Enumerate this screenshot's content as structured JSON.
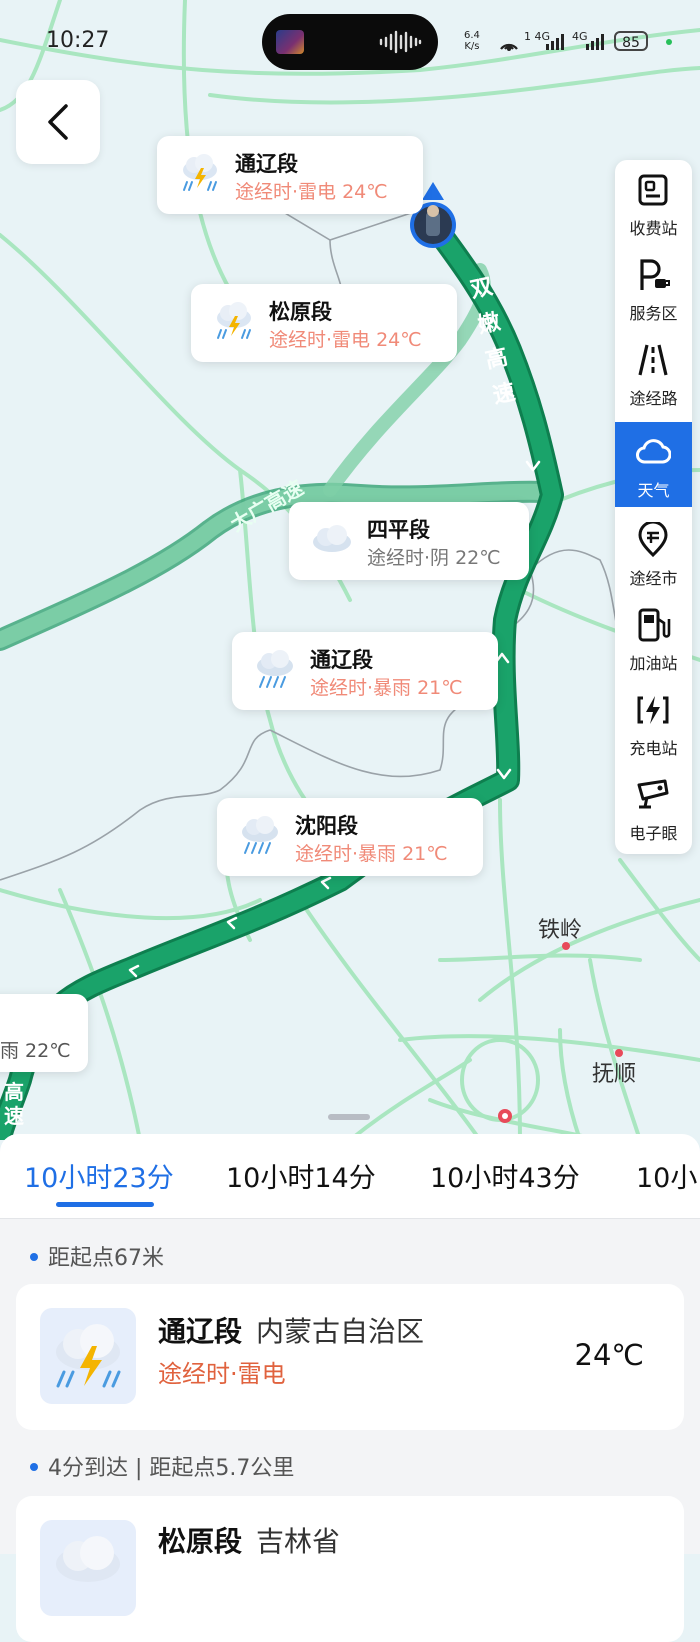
{
  "status_bar": {
    "time": "10:27",
    "net_speed_value": "6.4",
    "net_speed_unit": "K/s",
    "sim1": "1 4G",
    "sim2": "4G",
    "battery": "85"
  },
  "map": {
    "road_label": "双嫩高速",
    "road_label_2": "大广高速",
    "road_label_3": "高速",
    "cities": [
      "铁岭",
      "抚顺"
    ],
    "callouts": [
      {
        "name": "通辽段",
        "desc": "途经时·雷电 24℃",
        "icon": "thunderstorm-icon"
      },
      {
        "name": "松原段",
        "desc": "途经时·雷电 24℃",
        "icon": "thunderstorm-icon"
      },
      {
        "name": "四平段",
        "desc": "途经时·阴 22℃",
        "icon": "cloudy-icon"
      },
      {
        "name": "通辽段",
        "desc": "途经时·暴雨 21℃",
        "icon": "heavy-rain-icon"
      },
      {
        "name": "沈阳段",
        "desc": "途经时·暴雨 21℃",
        "icon": "heavy-rain-icon"
      },
      {
        "name": "",
        "desc": "雨 22℃",
        "icon": ""
      }
    ],
    "colors": {
      "route": "#1aa36a",
      "route_dark": "#0e7f4f",
      "road": "#9de3b6",
      "accent": "#1f6fe5"
    }
  },
  "sidebar": {
    "items": [
      {
        "label": "收费站",
        "icon": "toll-station-icon"
      },
      {
        "label": "服务区",
        "icon": "service-area-icon"
      },
      {
        "label": "途经路",
        "icon": "road-icon"
      },
      {
        "label": "天气",
        "icon": "weather-cloud-icon",
        "active": true
      },
      {
        "label": "途经市",
        "icon": "city-pin-icon"
      },
      {
        "label": "加油站",
        "icon": "gas-station-icon"
      },
      {
        "label": "充电站",
        "icon": "charging-station-icon"
      },
      {
        "label": "电子眼",
        "icon": "speed-camera-icon"
      }
    ]
  },
  "route_tabs": [
    "10小时23分",
    "10小时14分",
    "10小时43分",
    "10小"
  ],
  "weather_list": [
    {
      "meta": "距起点67米",
      "name": "通辽段",
      "region": "内蒙古自治区",
      "desc": "途经时·雷电",
      "temp": "24℃"
    },
    {
      "meta": "4分到达 | 距起点5.7公里",
      "name": "松原段",
      "region": "吉林省",
      "desc": "",
      "temp": ""
    }
  ]
}
